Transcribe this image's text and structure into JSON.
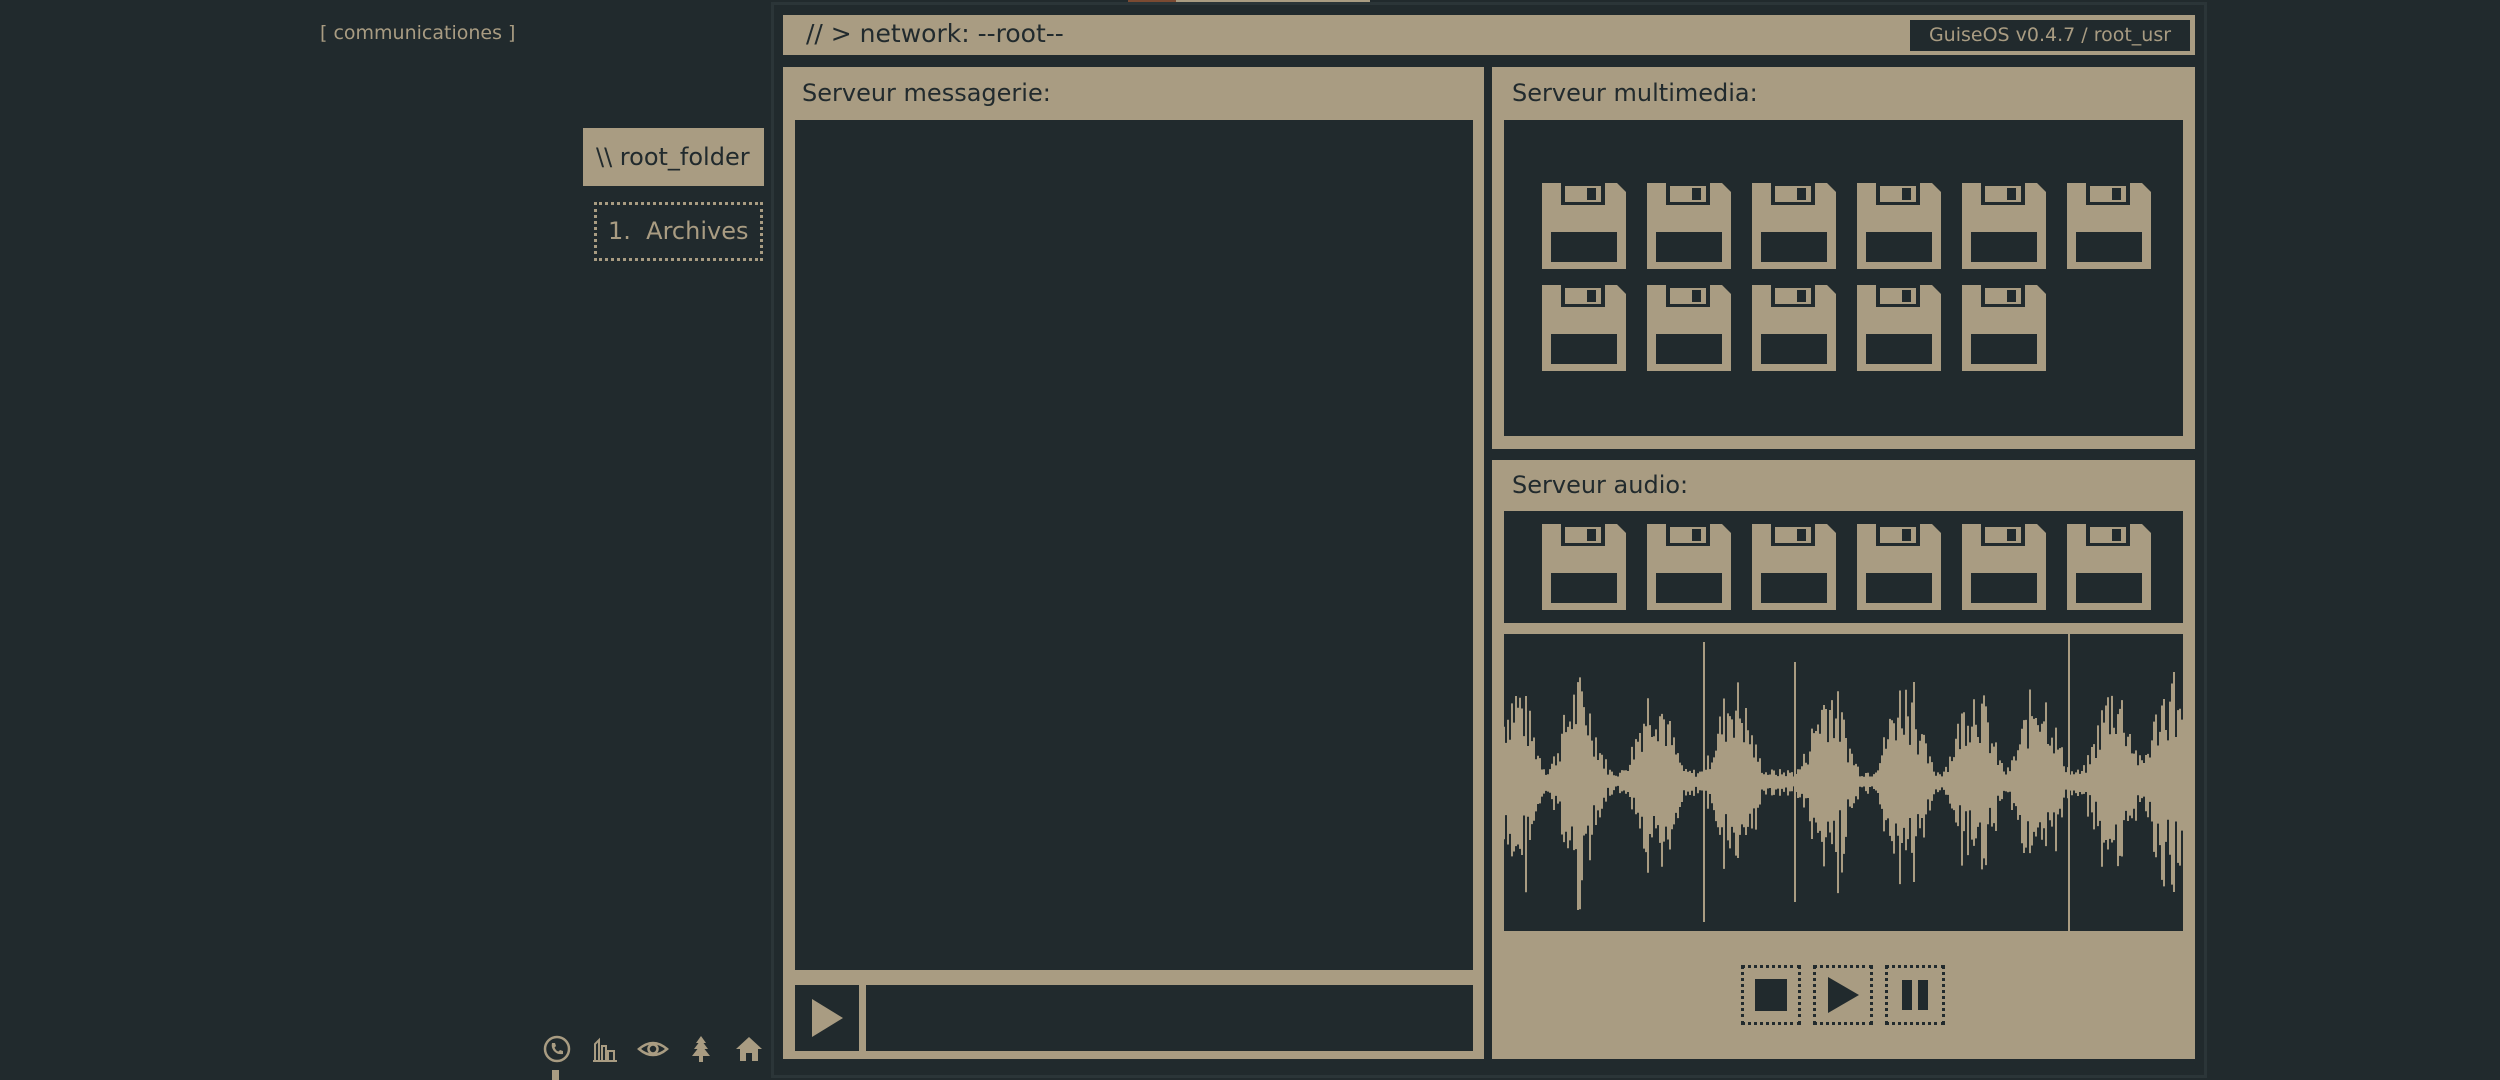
{
  "sidebar": {
    "section_label": "[ communicationes ]",
    "folder_tab": "\\\\ root_folder",
    "archives": "1.  Archives",
    "dock_icons": [
      "phone-icon",
      "city-icon",
      "eye-icon",
      "tree-icon",
      "home-icon"
    ]
  },
  "window": {
    "title": "// > network: --root--",
    "version": "GuiseOS v0.4.7 / root_usr"
  },
  "messaging": {
    "title": "Serveur messagerie:",
    "input_value": ""
  },
  "multimedia": {
    "title": "Serveur multimedia:",
    "file_count": 11
  },
  "audio": {
    "title": "Serveur audio:",
    "file_count": 6,
    "controls": [
      "stop-icon",
      "play-icon",
      "pause-icon"
    ]
  },
  "colors": {
    "background": "#212a2d",
    "accent": "#a99c82",
    "highlight": "#7b4a32"
  }
}
